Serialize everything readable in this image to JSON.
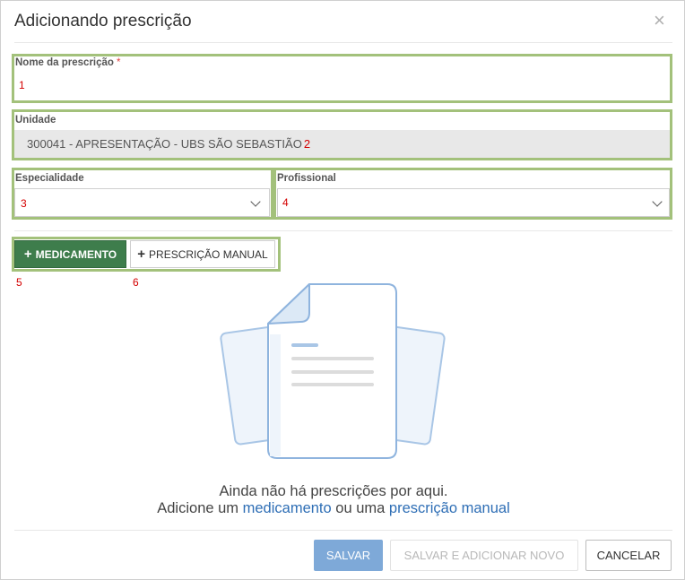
{
  "modal": {
    "title": "Adicionando prescrição",
    "close_label": "×"
  },
  "form": {
    "nome": {
      "label": "Nome da prescrição",
      "required_mark": "*",
      "value": "",
      "marker": "1"
    },
    "unidade": {
      "label": "Unidade",
      "value": "300041 - APRESENTAÇÃO - UBS SÃO SEBASTIÃO",
      "marker": "2"
    },
    "especialidade": {
      "label": "Especialidade",
      "value": "",
      "marker": "3"
    },
    "profissional": {
      "label": "Profissional",
      "value": "",
      "marker": "4"
    }
  },
  "actions": {
    "medicamento": {
      "icon": "plus-icon",
      "plus": "+",
      "label": "MEDICAMENTO",
      "marker": "5"
    },
    "prescricao_manual": {
      "icon": "plus-icon",
      "plus": "+",
      "label": "PRESCRIÇÃO MANUAL",
      "marker": "6"
    }
  },
  "empty_state": {
    "illustration": "document-stack-illustration",
    "line1": "Ainda não há prescrições por aqui.",
    "line2_prefix": "Adicione um ",
    "line2_link1": "medicamento",
    "line2_middle": " ou uma ",
    "line2_link2": "prescrição manual"
  },
  "footer": {
    "save": "SALVAR",
    "save_new": "SALVAR E ADICIONAR NOVO",
    "cancel": "CANCELAR"
  },
  "colors": {
    "highlight": "#a3c17b",
    "primary_green": "#3e7d4c",
    "save_blue": "#7ea9d8",
    "link_blue": "#2e6eb5",
    "marker_red": "#d40000"
  }
}
